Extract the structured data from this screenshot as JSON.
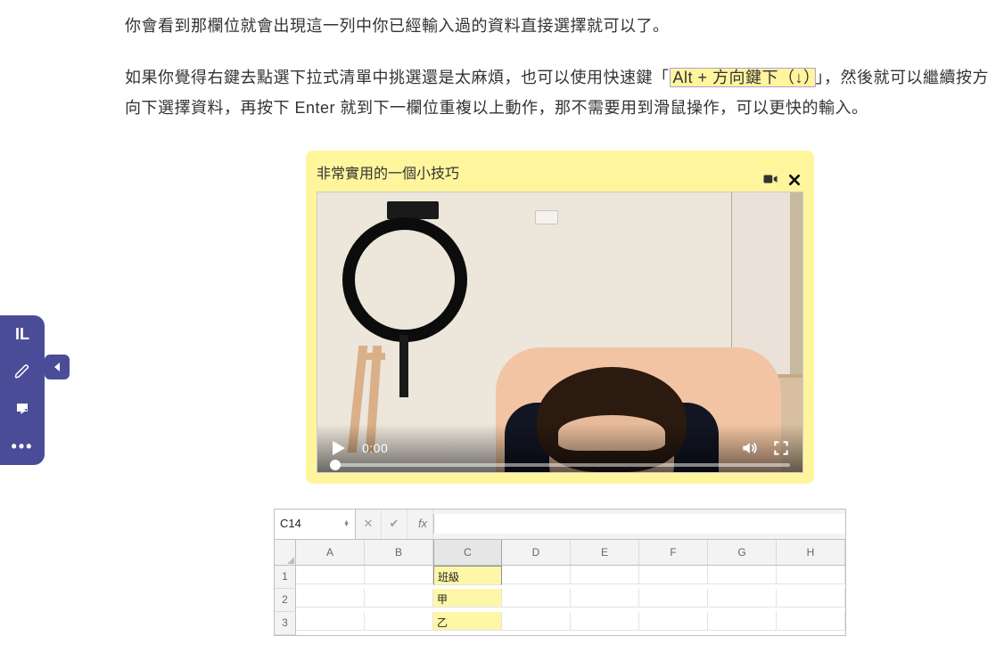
{
  "article": {
    "para1": "你會看到那欄位就會出現這一列中你已經輸入過的資料直接選擇就可以了。",
    "para2_a": "如果你覺得右鍵去點選下拉式清單中挑選還是太麻煩，也可以使用快速鍵「",
    "highlight": "Alt + 方向鍵下（↓）",
    "para2_b": "」，然後就可以繼續按方向下選擇資料，再按下 Enter 就到下一欄位重複以上動作，那不需要用到滑鼠操作，可以更快的輸入。"
  },
  "sidebar": {
    "logo_text": "IL",
    "pencil": "✎",
    "note": "▢",
    "more": "•••"
  },
  "video": {
    "title": "非常實用的一個小技巧",
    "time": "0:00"
  },
  "spreadsheet": {
    "name_box": "C14",
    "fx_label": "fx",
    "cols": [
      "A",
      "B",
      "C",
      "D",
      "E",
      "F",
      "G",
      "H"
    ],
    "rows": [
      {
        "n": "1",
        "C": "班級"
      },
      {
        "n": "2",
        "C": "甲"
      },
      {
        "n": "3",
        "C": "乙"
      }
    ]
  }
}
